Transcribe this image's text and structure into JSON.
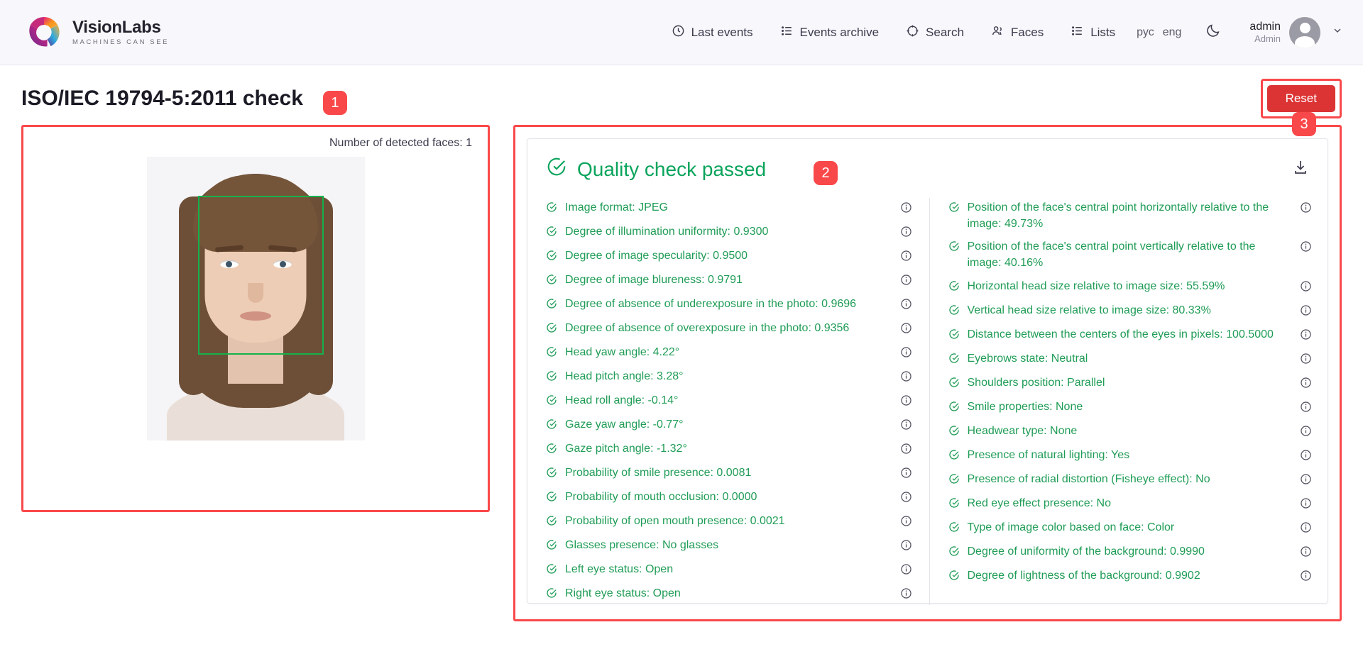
{
  "brand": {
    "name": "VisionLabs",
    "tagline": "MACHINES CAN SEE",
    "logo_icon": "visionlabs-ring-logo"
  },
  "nav": {
    "items": [
      {
        "label": "Last events",
        "icon": "clock-icon"
      },
      {
        "label": "Events archive",
        "icon": "list-icon"
      },
      {
        "label": "Search",
        "icon": "target-search-icon"
      },
      {
        "label": "Faces",
        "icon": "people-icon"
      },
      {
        "label": "Lists",
        "icon": "list-icon"
      }
    ]
  },
  "locale": {
    "ru_label": "рус",
    "en_label": "eng",
    "theme_icon": "moon-icon"
  },
  "user": {
    "login": "admin",
    "role": "Admin",
    "avatar_icon": "user-avatar-icon",
    "chevron_icon": "chevron-down-icon"
  },
  "page": {
    "title": "ISO/IEC 19794-5:2011 check",
    "reset_label": "Reset"
  },
  "markers": {
    "one": "1",
    "two": "2",
    "three": "3"
  },
  "left_panel": {
    "faces_count_label": "Number of detected faces: 1",
    "detection_box_color": "#14b14b"
  },
  "result": {
    "status_title": "Quality check passed",
    "status_icon": "check-circle-icon",
    "status_color": "#0aa45c",
    "download_icon": "download-icon",
    "left_checks": [
      "Image format: JPEG",
      "Degree of illumination uniformity: 0.9300",
      "Degree of image specularity: 0.9500",
      "Degree of image blureness: 0.9791",
      "Degree of absence of underexposure in the photo: 0.9696",
      "Degree of absence of overexposure in the photo: 0.9356",
      "Head yaw angle: 4.22°",
      "Head pitch angle: 3.28°",
      "Head roll angle: -0.14°",
      "Gaze yaw angle: -0.77°",
      "Gaze pitch angle: -1.32°",
      "Probability of smile presence: 0.0081",
      "Probability of mouth occlusion: 0.0000",
      "Probability of open mouth presence: 0.0021",
      "Glasses presence: No glasses",
      "Left eye status: Open",
      "Right eye status: Open"
    ],
    "right_checks": [
      "Position of the face's central point horizontally relative to the image: 49.73%",
      "Position of the face's central point vertically relative to the image: 40.16%",
      "Horizontal head size relative to image size: 55.59%",
      "Vertical head size relative to image size: 80.33%",
      "Distance between the centers of the eyes in pixels: 100.5000",
      "Eyebrows state: Neutral",
      "Shoulders position: Parallel",
      "Smile properties: None",
      "Headwear type: None",
      "Presence of natural lighting: Yes",
      "Presence of radial distortion (Fisheye effect): No",
      "Red eye effect presence: No",
      "Type of image color based on face: Color",
      "Degree of uniformity of the background: 0.9990",
      "Degree of lightness of the background: 0.9902"
    ]
  },
  "colors": {
    "accent_red": "#f9484a",
    "success_green": "#0aa45c",
    "header_bg": "#f8f7fb"
  }
}
